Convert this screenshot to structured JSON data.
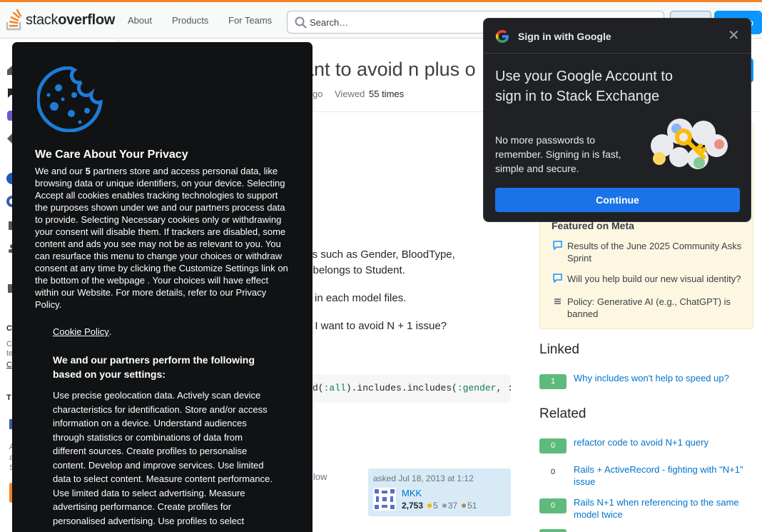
{
  "header": {
    "logo_text_plain": "stack",
    "logo_text_bold": "overflow",
    "nav": [
      "About",
      "Products",
      "For Teams"
    ],
    "search_placeholder": "Search…",
    "signup_partial": "p"
  },
  "question": {
    "title_partial": "ant to avoid n plus o",
    "asked_partial": "go",
    "viewed_label": "Viewed",
    "viewed_value": "55 times",
    "body_lines": [
      "els such as Gender, BloodType,",
      "n belongs to Student.",
      "in each model files.",
      "f I want to avoid N + 1 issue?"
    ],
    "code": {
      "part1": "d(",
      "sym1": ":all",
      "part2": ").includes.includes(",
      "sym2": ":gender",
      "part3": ", :"
    },
    "follow_partial": "llow",
    "asked": {
      "label": "asked Jul 18, 2013 at 1:12",
      "user": "MKK",
      "reputation": "2,753",
      "gold": "5",
      "silver": "37",
      "bronze": "51",
      "gold_color": "#f1b600",
      "silver_color": "#9a9b9e",
      "bronze_color": "#ab8a5f"
    }
  },
  "left_sidebar": {
    "labels": [
      "C",
      "C",
      "te",
      "C",
      "T",
      "A",
      "a",
      "S"
    ]
  },
  "cookie_dialog": {
    "title": "We Care About Your Privacy",
    "body_pre": "We and our ",
    "body_count": "5",
    "body_post": " partners store and access personal data, like browsing data or unique identifiers, on your device. Selecting Accept all cookies enables tracking technologies to support the purposes shown under we and our partners process data to provide. Selecting Necessary cookies only or withdrawing your consent will disable them. If trackers are disabled, some content and ads you see may not be as relevant to you. You can resurface this menu to change your choices or withdraw consent at any time by clicking the Customize Settings link on the bottom of the webpage . Your choices will have effect within our Website. For more details, refer to our Privacy Policy.",
    "cookie_policy_link": "Cookie Policy",
    "cookie_policy_dot": ".",
    "subtitle": "We and our partners perform the following based on your settings:",
    "purposes": "Use precise geolocation data. Actively scan device characteristics for identification. Store and/or access information on a device. Understand audiences through statistics or combinations of data from different sources. Create profiles to personalise content. Develop and improve services. Use limited data to select content. Measure content performance. Use limited data to select advertising. Measure advertising performance. Create profiles for personalised advertising. Use profiles to select"
  },
  "google_popup": {
    "header": "Sign in with Google",
    "title": "Use your Google Account to sign in to Stack Exchange",
    "description": "No more passwords to remember. Signing in is fast, simple and secure.",
    "button": "Continue"
  },
  "right_sidebar": {
    "featured_title": "Featured on Meta",
    "featured": [
      "Results of the June 2025 Community Asks Sprint",
      "Will you help build our new visual identity?",
      "Policy: Generative AI (e.g., ChatGPT) is banned"
    ],
    "linked_title": "Linked",
    "linked": [
      {
        "score": "1",
        "title": "Why includes won't help to speed up?"
      }
    ],
    "related_title": "Related",
    "related": [
      {
        "score": "0",
        "title": "refactor code to avoid N+1 query",
        "answered": true
      },
      {
        "score": "0",
        "title": "Rails + ActiveRecord - fighting with \"N+1\" issue",
        "answered": false
      },
      {
        "score": "0",
        "title": "Rails N+1 when referencing to the same model twice",
        "answered": true
      }
    ]
  }
}
